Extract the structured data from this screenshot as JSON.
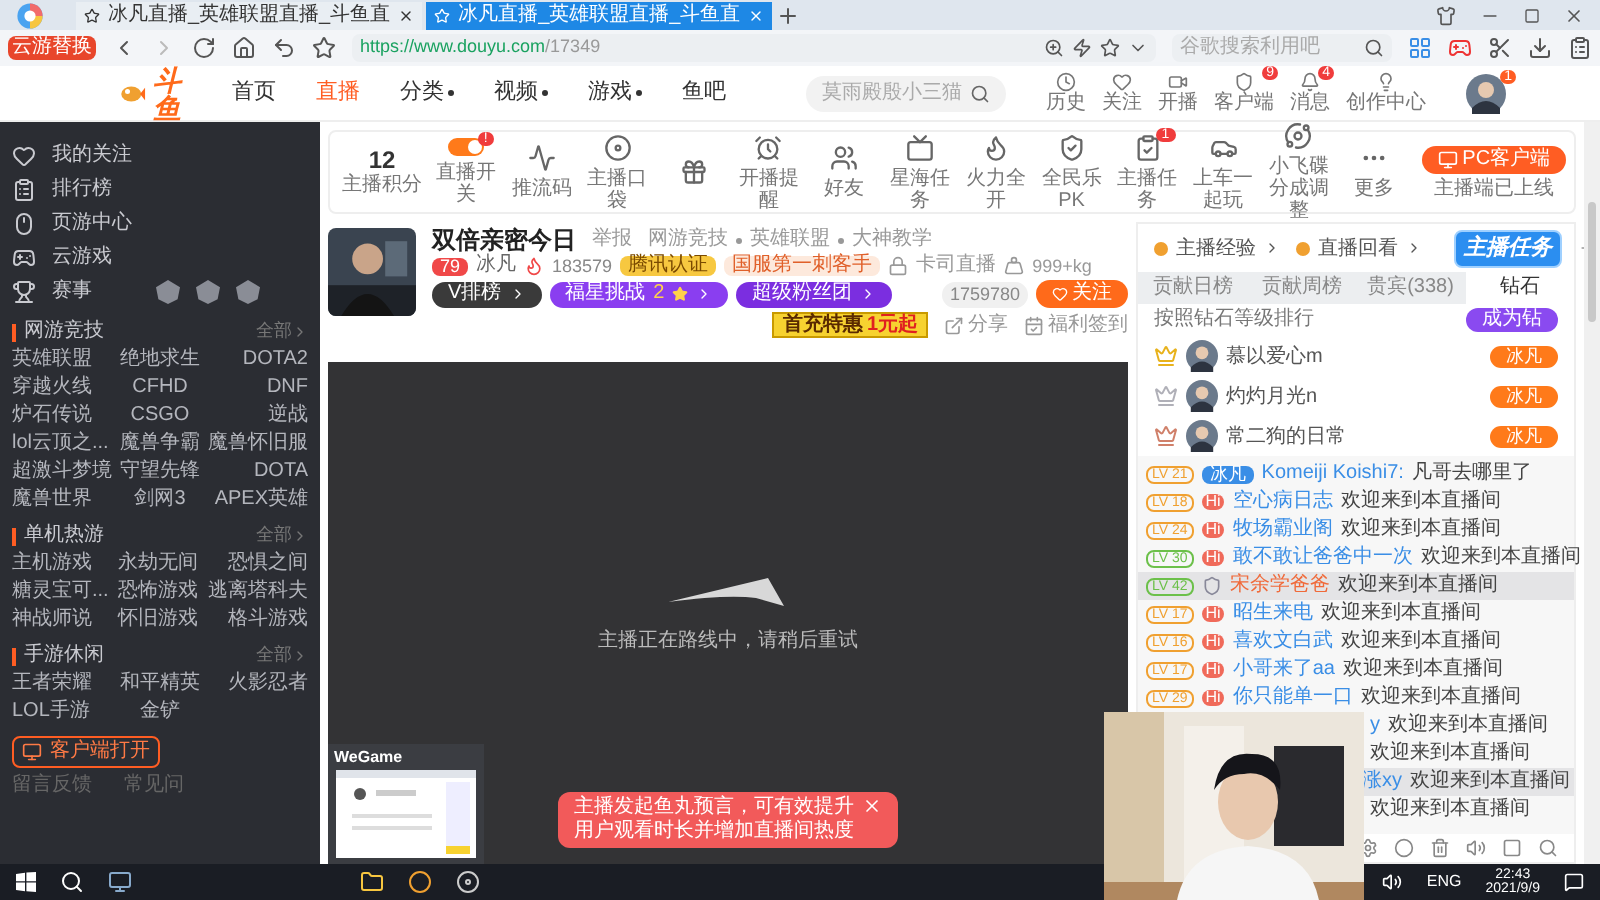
{
  "browser": {
    "logo_badge": "云游替换",
    "tabs": [
      {
        "title": "冰凡直播_英雄联盟直播_斗鱼直",
        "selected": false
      },
      {
        "title": "冰凡直播_英雄联盟直播_斗鱼直",
        "selected": true
      }
    ],
    "url_host": "https://www.douyu.com",
    "url_path": "/17349",
    "search_placeholder": "谷歌搜索利用吧"
  },
  "site": {
    "logo": "斗鱼",
    "nav": [
      {
        "label": "首页",
        "selected": false,
        "dropdown": false
      },
      {
        "label": "直播",
        "selected": true,
        "dropdown": false
      },
      {
        "label": "分类",
        "selected": false,
        "dropdown": true
      },
      {
        "label": "视频",
        "selected": false,
        "dropdown": true
      },
      {
        "label": "游戏",
        "selected": false,
        "dropdown": true
      },
      {
        "label": "鱼吧",
        "selected": false,
        "dropdown": false
      }
    ],
    "search_placeholder": "莫雨殿殷小三猫",
    "actions": [
      {
        "kind": "clock",
        "label": "历史"
      },
      {
        "kind": "heart",
        "label": "关注"
      },
      {
        "kind": "video",
        "label": "开播"
      },
      {
        "kind": "shield",
        "label": "客户端",
        "badge": "9"
      },
      {
        "kind": "bell",
        "label": "消息",
        "badge": "4"
      },
      {
        "kind": "bulb",
        "label": "创作中心"
      }
    ],
    "avatar_badge": "1"
  },
  "sidebar": {
    "links": [
      {
        "kind": "heart",
        "label": "我的关注"
      },
      {
        "kind": "rank",
        "label": "排行榜"
      },
      {
        "kind": "mouse",
        "label": "页游中心"
      },
      {
        "kind": "gamepad",
        "label": "云游戏"
      },
      {
        "kind": "trophy",
        "label": "赛事"
      }
    ],
    "sections": [
      {
        "title": "网游竞技",
        "more": "全部",
        "games": [
          "英雄联盟",
          "绝地求生",
          "DOTA2",
          "穿越火线",
          "CFHD",
          "DNF",
          "炉石传说",
          "CSGO",
          "逆战",
          "lol云顶之...",
          "魔兽争霸",
          "魔兽怀旧服",
          "超激斗梦境",
          "守望先锋",
          "DOTA",
          "魔兽世界",
          "剑网3",
          "APEX英雄"
        ]
      },
      {
        "title": "单机热游",
        "more": "全部",
        "games": [
          "主机游戏",
          "永劫无间",
          "恐惧之间",
          "糖灵宝可...",
          "恐怖游戏",
          "逃离塔科夫",
          "神战师说",
          "怀旧游戏",
          "格斗游戏"
        ]
      },
      {
        "title": "手游休闲",
        "more": "全部",
        "games": [
          "王者荣耀",
          "和平精英",
          "火影忍者",
          "LOL手游",
          "金铲"
        ]
      }
    ],
    "client_button": "客户端打开",
    "footer": [
      "留言反馈",
      "常见问"
    ]
  },
  "toolbar": {
    "score": "12",
    "score_label": "主播积分",
    "items": [
      {
        "kind": "toggle",
        "label": "直播开关",
        "on": true,
        "badge": "!"
      },
      {
        "kind": "wave",
        "label": "推流码"
      },
      {
        "kind": "pouch",
        "label": "主播口袋"
      },
      {
        "kind": "gift"
      },
      {
        "kind": "alarm",
        "label": "开播提醒"
      },
      {
        "kind": "friends",
        "label": "好友"
      },
      {
        "kind": "ad",
        "label": "星海任务"
      },
      {
        "kind": "fire",
        "label": "火力全开"
      },
      {
        "kind": "pk",
        "label": "全民乐PK"
      },
      {
        "kind": "task",
        "label": "主播任务",
        "badge": "1"
      },
      {
        "kind": "car",
        "label": "上车一起玩"
      },
      {
        "kind": "ufo",
        "label": "小飞碟分成调整"
      },
      {
        "kind": "more",
        "label": "更多"
      }
    ],
    "pc_button": "PC客户端",
    "pc_note": "主播端已上线"
  },
  "stream": {
    "title": "双倍亲密今日",
    "report": "举报",
    "category": [
      "网游竞技",
      "英雄联盟",
      "大神教学"
    ],
    "level": "79",
    "streamer": "冰凡",
    "heat": "183579",
    "tags": [
      "腾讯认证",
      "国服第一刺客手"
    ],
    "status": "卡司直播",
    "weight": "999+kg",
    "badges": [
      "V排榜",
      "福星挑战",
      "超级粉丝团"
    ],
    "star_count": "2",
    "followers": "1759780",
    "follow": "关注",
    "promo_label": "首充特惠",
    "promo_value": "1元起",
    "share": "分享",
    "checkin": "福利签到"
  },
  "video": {
    "message": "主播正在路线中，请稍后重试",
    "toast": "主播发起鱼丸预言，可有效提升用户观看时长并增加直播间热度"
  },
  "chat": {
    "links": [
      "主播经验",
      "直播回看"
    ],
    "sticker": "主播任务",
    "tabs": [
      {
        "label": "贡献日榜",
        "selected": false
      },
      {
        "label": "贡献周榜",
        "selected": false
      },
      {
        "label": "贵宾(338)",
        "selected": false
      },
      {
        "label": "钻石",
        "selected": true
      }
    ],
    "rank_title": "按照钻石等级排行",
    "join": "成为钻",
    "top": [
      {
        "name": "慕以爱心m",
        "badge": "冰凡",
        "color": "#e8b21c"
      },
      {
        "name": "灼灼月光n",
        "badge": "冰凡",
        "color": "#b0b0b8"
      },
      {
        "name": "常二狗的日常",
        "badge": "冰凡",
        "color": "#d0806a"
      }
    ],
    "messages": [
      {
        "level": "LV 21",
        "color": "#f0a030",
        "kind": "fan",
        "badge": "冰凡",
        "name": "Komeiji Koishi7:",
        "text": "凡哥去哪里了",
        "highlighted": false
      },
      {
        "level": "LV 18",
        "color": "#f0a030",
        "kind": "hi",
        "badge": "Hi",
        "name": "空心病日志",
        "text": "欢迎来到本直播间",
        "highlighted": false
      },
      {
        "level": "LV 24",
        "color": "#f0a030",
        "kind": "hi",
        "badge": "Hi",
        "name": "牧场霸业阁",
        "text": "欢迎来到本直播间",
        "highlighted": false
      },
      {
        "level": "LV 30",
        "color": "#6cc04a",
        "kind": "hi",
        "badge": "Hi",
        "name": "敢不敢让爸爸中一次",
        "text": "欢迎来到本直播间",
        "highlighted": false
      },
      {
        "level": "LV 42",
        "color": "#6cc04a",
        "kind": "noble",
        "name": "宋余学爸爸",
        "text": "欢迎来到本直播间",
        "highlighted": true
      },
      {
        "level": "LV 17",
        "color": "#f0a030",
        "kind": "hi",
        "badge": "Hi",
        "name": "昭生来电",
        "text": "欢迎来到本直播间",
        "highlighted": false
      },
      {
        "level": "LV 16",
        "color": "#f0a030",
        "kind": "hi",
        "badge": "Hi",
        "name": "喜欢文白武",
        "text": "欢迎来到本直播间",
        "highlighted": false
      },
      {
        "level": "LV 17",
        "color": "#f0a030",
        "kind": "hi",
        "badge": "Hi",
        "name": "小哥来了aa",
        "text": "欢迎来到本直播间",
        "highlighted": false
      },
      {
        "level": "LV 29",
        "color": "#f0a030",
        "kind": "hi",
        "badge": "Hi",
        "name": "你只能单一口",
        "text": "欢迎来到本直播间",
        "highlighted": false
      }
    ],
    "partial_messages": [
      {
        "name": "y",
        "text": "欢迎来到本直播间",
        "highlighted": false
      },
      {
        "text": "欢迎来到本直播间",
        "highlighted": false
      },
      {
        "name": "涨xy",
        "text": "欢迎来到本直播间",
        "highlighted": true
      },
      {
        "text": "欢迎来到本直播间",
        "highlighted": false
      }
    ]
  },
  "taskbar": {
    "popup_title": "WeGame",
    "language": "ENG",
    "time": "22:43",
    "date": "2021/9/9"
  }
}
